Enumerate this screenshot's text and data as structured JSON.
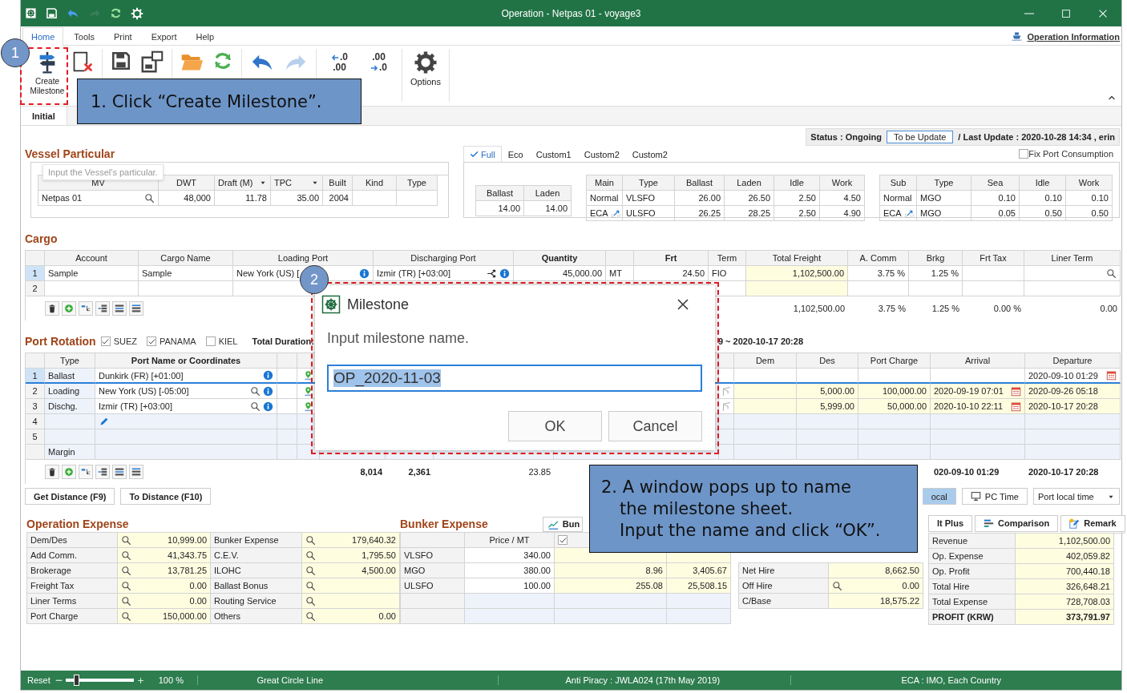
{
  "title_bar": {
    "title": "Operation - Netpas 01 - voyage3"
  },
  "menu_tabs": [
    {
      "label": "Home",
      "selected": true
    },
    {
      "label": "Tools",
      "selected": false
    },
    {
      "label": "Print",
      "selected": false
    },
    {
      "label": "Export",
      "selected": false
    },
    {
      "label": "Help",
      "selected": false
    }
  ],
  "operation_info_link": "Operation Information",
  "ribbon": {
    "create_milestone": "Create Milestone",
    "decrease_decimal": {
      "top": ".0",
      "bottom": ".00"
    },
    "increase_decimal": {
      "top": ".00",
      "bottom": ".0"
    },
    "options": "Options"
  },
  "sheet_tabs": [
    {
      "label": "Initial",
      "selected": true
    }
  ],
  "status": {
    "label": "Status : Ongoing",
    "button": "To be Update",
    "last_update": "/ Last Update : 2020-10-28 14:34 , erin"
  },
  "vessel": {
    "title": "Vessel Particular",
    "tooltip": "Input the Vessel's particular.",
    "columns": [
      "MV",
      "DWT",
      "Draft (M)",
      "TPC",
      "Built",
      "Kind",
      "Type"
    ],
    "rows": [
      {
        "mv": "Netpas 01",
        "dwt": "48,000",
        "draft": "11.78",
        "tpc": "35.00",
        "built": "2004"
      }
    ]
  },
  "consumption_tabs": [
    {
      "label": "Full",
      "selected": true
    },
    {
      "label": "Eco",
      "selected": false
    },
    {
      "label": "Custom1",
      "selected": false
    },
    {
      "label": "Custom2",
      "selected": false
    },
    {
      "label": "Custom2",
      "selected": false
    }
  ],
  "fix_port_consumption": {
    "label": "Fix Port Consumption",
    "checked": false
  },
  "speed": {
    "columns": [
      "Ballast",
      "Laden"
    ],
    "rows": [
      {
        "ballast": "14.00",
        "laden": "14.00"
      }
    ]
  },
  "main_consumption": {
    "columns": [
      "Main",
      "Type",
      "Ballast",
      "Laden",
      "Idle",
      "Work"
    ],
    "rows": [
      {
        "main": "Normal",
        "type": "VLSFO",
        "ballast": "26.00",
        "laden": "26.50",
        "idle": "2.50",
        "work": "4.50"
      },
      {
        "main": "ECA",
        "type": "ULSFO",
        "ballast": "26.25",
        "laden": "28.25",
        "idle": "2.50",
        "work": "4.90"
      }
    ]
  },
  "sub_consumption": {
    "columns": [
      "Sub",
      "Type",
      "Sea",
      "Idle",
      "Work"
    ],
    "rows": [
      {
        "sub": "Normal",
        "type": "MGO",
        "sea": "0.10",
        "idle": "0.10",
        "work": "0.10"
      },
      {
        "sub": "ECA",
        "type": "MGO",
        "sea": "0.05",
        "idle": "0.50",
        "work": "0.50"
      }
    ]
  },
  "cargo": {
    "title": "Cargo",
    "columns": [
      "Account",
      "Cargo Name",
      "Loading Port",
      "Discharging Port",
      "Quantity",
      "Frt",
      "Term",
      "Total Freight",
      "A. Comm",
      "Brkg",
      "Frt Tax",
      "Liner Term"
    ],
    "rows": [
      {
        "no": "1",
        "selected": true,
        "account": "Sample",
        "cargo_name": "Sample",
        "loading_port": "New York (US) [",
        "discharging_port": "Izmir (TR) [+03:00]",
        "quantity": "45,000.00",
        "unit": "MT",
        "frt": "24.50",
        "term": "FIO",
        "total_freight": "1,102,500.00",
        "a_comm": "3.75 %",
        "brkg": "1.25 %"
      },
      {
        "no": "2",
        "selected": false
      }
    ],
    "totals": {
      "total_freight": "1,102,500.00",
      "a_comm": "3.75 %",
      "brkg": "1.25 %",
      "frt_tax": "0.00 %",
      "liner_term": "0.00"
    }
  },
  "port_rotation": {
    "title": "Port Rotation",
    "canals": [
      {
        "label": "SUEZ",
        "checked": true
      },
      {
        "label": "PANAMA",
        "checked": true
      },
      {
        "label": "KIEL",
        "checked": false
      }
    ],
    "total_duration_label": "Total Duration:",
    "duration_end": "9 ~ 2020-10-17 20:28",
    "columns": [
      "Type",
      "Port Name or Coordinates",
      "Dem",
      "Des",
      "Port Charge",
      "Arrival",
      "Departure"
    ],
    "rows": [
      {
        "no": "1",
        "selected": true,
        "type": "Ballast",
        "port": "Dunkirk (FR) [+01:00]",
        "departure": "2020-09-10 01:29"
      },
      {
        "no": "2",
        "selected": false,
        "type": "Loading",
        "port": "New York (US) [-05:00]",
        "des": "5,000.00",
        "port_charge": "100,000.00",
        "arrival": "2020-09-19 07:01",
        "departure": "2020-09-26 05:18"
      },
      {
        "no": "3",
        "selected": false,
        "type": "Dischg.",
        "port": "Izmir (TR) [+03:00]",
        "des": "5,999.00",
        "port_charge": "50,000.00",
        "arrival": "2020-10-10 22:11",
        "departure": "2020-10-17 20:28"
      },
      {
        "no": "4",
        "selected": false
      },
      {
        "no": "5",
        "selected": false
      },
      {
        "selected": false,
        "type": "Margin"
      }
    ],
    "totals": {
      "column_5": "8,014",
      "column_6": "2,361",
      "column_7": "23.85",
      "arrival": "020-09-10 01:29",
      "departure": "2020-10-17 20:28"
    }
  },
  "distance_buttons": [
    "Get Distance (F9)",
    "To Distance (F10)"
  ],
  "time_buttons": [
    {
      "label": "ocal",
      "selected": true
    },
    {
      "label": "PC Time",
      "selected": false
    }
  ],
  "time_mode": "Port local time",
  "operation_expense": {
    "title": "Operation Expense",
    "rows": [
      {
        "label": "Dem/Des",
        "value": "10,999.00",
        "label2": "Bunker Expense",
        "value2": "179,640.32"
      },
      {
        "label": "Add Comm.",
        "value": "41,343.75",
        "label2": "C.E.V.",
        "value2": "1,795.50"
      },
      {
        "label": "Brokerage",
        "value": "13,781.25",
        "label2": "ILOHC",
        "value2": "4,500.00"
      },
      {
        "label": "Freight Tax",
        "value": "0.00",
        "label2": "Ballast Bonus"
      },
      {
        "label": "Liner Terms",
        "value": "0.00",
        "label2": "Routing Service"
      },
      {
        "label": "Port Charge",
        "value": "150,000.00",
        "label2": "Others",
        "value2": "0.00"
      }
    ]
  },
  "bunker_expense": {
    "title": "Bunker Expense",
    "button": "Bun",
    "columns": [
      "Price / MT"
    ],
    "column_3_checked": true,
    "rows": [
      {
        "fuel": "VLSFO",
        "price": "340.00"
      },
      {
        "fuel": "MGO",
        "price": "380.00",
        "column_3": "8.96",
        "column_4": "3,405.67"
      },
      {
        "fuel": "ULSFO",
        "price": "100.00",
        "column_3": "255.08",
        "column_4": "25,508.15"
      },
      {},
      {}
    ]
  },
  "hire": [
    {
      "label": "Net Hire",
      "value": "8,662.50"
    },
    {
      "label": "Off Hire",
      "value": "0.00"
    },
    {
      "label": "C/Base",
      "value": "18,575.22"
    }
  ],
  "result_buttons": [
    "lt Plus",
    "Comparison",
    "Remark"
  ],
  "result": [
    {
      "kind": "line",
      "label": "Revenue",
      "value": "1,102,500.00"
    },
    {
      "kind": "line",
      "label": "Op. Expense",
      "value": "402,059.82"
    },
    {
      "kind": "line",
      "label": "Op. Profit",
      "value": "700,440.18"
    },
    {
      "kind": "line",
      "label": "Total Hire",
      "value": "326,648.21"
    },
    {
      "kind": "line",
      "label": "Total Expense",
      "value": "728,708.03"
    },
    {
      "kind": "total",
      "label": "PROFIT (KRW)",
      "value": "373,791.97"
    }
  ],
  "status_bar": {
    "reset": "Reset",
    "zoom": {
      "level": 0.15
    },
    "zoom_text": "100 %",
    "items": [
      "Great Circle Line",
      "Anti Piracy : JWLA024 (17th May 2019)",
      "ECA : IMO, Each Country"
    ]
  },
  "dialog": {
    "title": "Milestone",
    "prompt": "Input milestone name.",
    "value": "OP_2020-11-03",
    "buttons": [
      "OK",
      "Cancel"
    ]
  },
  "callouts": [
    {
      "number": "1",
      "lines": [
        "1.  Click “Create Milestone”."
      ]
    },
    {
      "number": "2",
      "lines": [
        "2. A window pops up to name",
        "the milestone sheet.",
        "Input the name and click “OK”."
      ]
    }
  ]
}
